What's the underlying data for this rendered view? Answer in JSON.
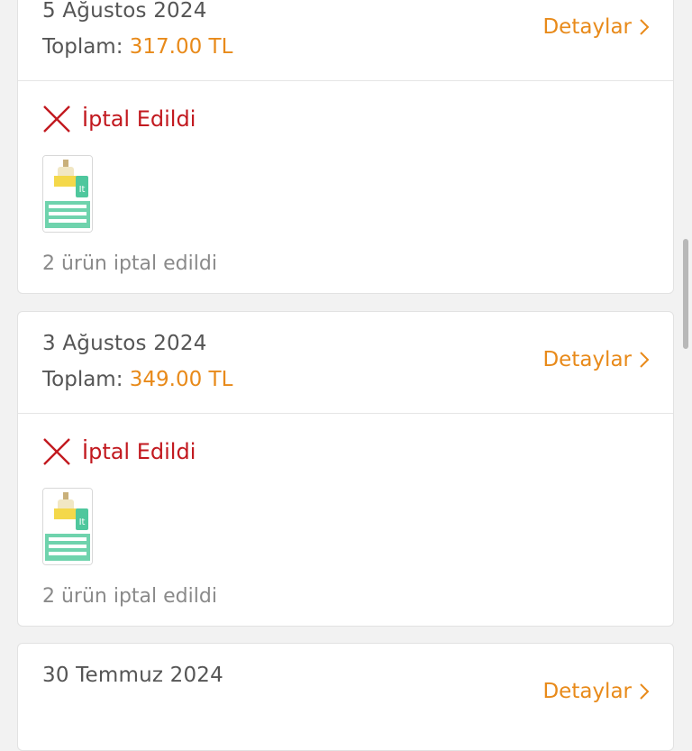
{
  "orders": [
    {
      "date": "5 Ağustos 2024",
      "total_label": "Toplam:",
      "total_amount": "317.00 TL",
      "details_label": "Detaylar",
      "status": "İptal Edildi",
      "note": "2 ürün iptal edildi"
    },
    {
      "date": "3 Ağustos 2024",
      "total_label": "Toplam:",
      "total_amount": "349.00 TL",
      "details_label": "Detaylar",
      "status": "İptal Edildi",
      "note": "2 ürün iptal edildi"
    },
    {
      "date": "30 Temmuz 2024",
      "details_label": "Detaylar"
    }
  ],
  "colors": {
    "accent": "#e88a1a",
    "cancelled": "#c2191f",
    "muted": "#8a8a8a"
  },
  "icons": {
    "status": "close-x-icon",
    "details": "chevron-right-icon",
    "product": "product-thumbnail"
  }
}
